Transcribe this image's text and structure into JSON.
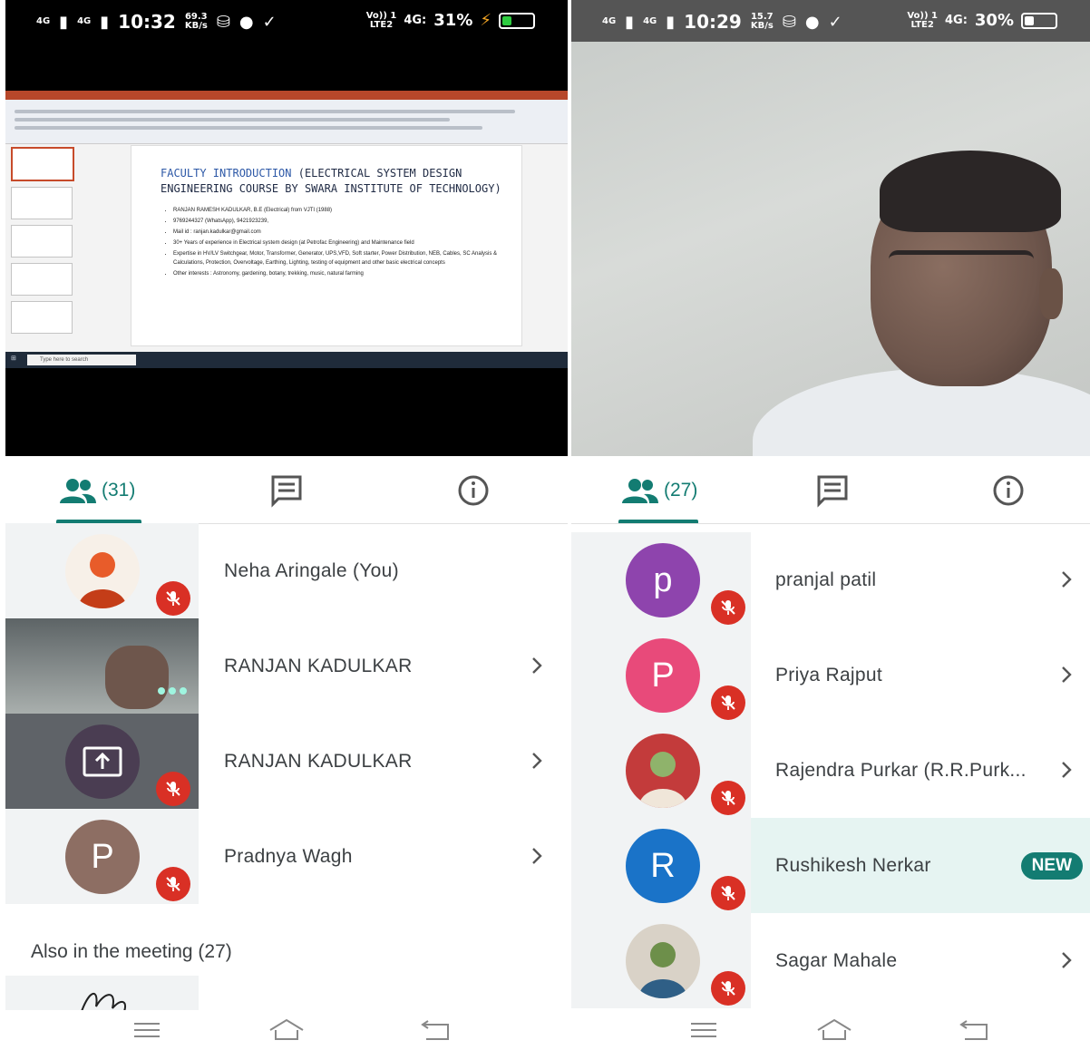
{
  "left": {
    "status": {
      "signal1": "4G",
      "signal2": "4G",
      "time": "10:32",
      "speed_value": "69.3",
      "speed_unit": "KB/s",
      "volte": "Vo)) 1",
      "lte": "LTE2",
      "net": "4G:",
      "battery": "31%",
      "battery_level": 0.31
    },
    "slide": {
      "title_accent": "FACULTY INTRODUCTION",
      "title_rest": "(ELECTRICAL SYSTEM DESIGN",
      "title_line2": "ENGINEERING COURSE BY SWARA INSTITUTE OF TECHNOLOGY)",
      "bullets": [
        "RANJAN RAMESH KADULKAR, B.E (Electrical) from VJTI (1988)",
        "9769244327 (WhatsApp), 9421923239,",
        "Mail id : ranjan.kadulkar@gmail.com",
        "30+ Years of experience in Electrical system design (at Petrofac Engineering) and Maintenance field",
        "Expertise in HV/LV Switchgear, Motor, Transformer, Generator, UPS,VFD, Soft starter, Power Distribution, NEB, Cables, SC Analysis & Calculations, Protection, Overvoltage, Earthing, Lighting, testing of equipment and other basic electrical concepts",
        "Other interests : Astronomy, gardening, botany, trekking, music, natural farming"
      ],
      "taskbar_search": "Type here to search"
    },
    "tab_count": "(31)",
    "participants": [
      {
        "name": "Neha Aringale (You)",
        "avatar": "photo",
        "chevron": false
      },
      {
        "name": "RANJAN KADULKAR",
        "avatar": "video",
        "chevron": true
      },
      {
        "name": "RANJAN KADULKAR",
        "avatar": "present-icon",
        "chevron": true
      },
      {
        "name": "Pradnya Wagh",
        "avatar": "P",
        "avatar_color": "#8d6e63",
        "chevron": true
      }
    ],
    "also_title": "Also in the meeting (27)"
  },
  "right": {
    "status": {
      "signal1": "4G",
      "signal2": "4G",
      "time": "10:29",
      "speed_value": "15.7",
      "speed_unit": "KB/s",
      "volte": "Vo)) 1",
      "lte": "LTE2",
      "net": "4G:",
      "battery": "30%",
      "battery_level": 0.3
    },
    "tab_count": "(27)",
    "participants": [
      {
        "name": "pranjal patil",
        "avatar": "p",
        "avatar_color": "#8e44ad",
        "chevron": true
      },
      {
        "name": "Priya Rajput",
        "avatar": "P",
        "avatar_color": "#e84a7a",
        "chevron": true
      },
      {
        "name": "Rajendra Purkar (R.R.Purk...",
        "avatar": "photo",
        "chevron": true
      },
      {
        "name": "Rushikesh Nerkar",
        "avatar": "R",
        "avatar_color": "#1a73c8",
        "badge": "NEW"
      },
      {
        "name": "Sagar Mahale",
        "avatar": "photo",
        "chevron": true
      }
    ]
  },
  "colors": {
    "accent": "#137c72",
    "mic_off": "#d93025",
    "highlight_row": "#e6f4f2"
  },
  "icons": [
    "people-icon",
    "chat-icon",
    "info-icon",
    "mic-off-icon",
    "chevron-right-icon",
    "menu-icon",
    "home-icon",
    "back-icon",
    "present-screen-icon"
  ]
}
